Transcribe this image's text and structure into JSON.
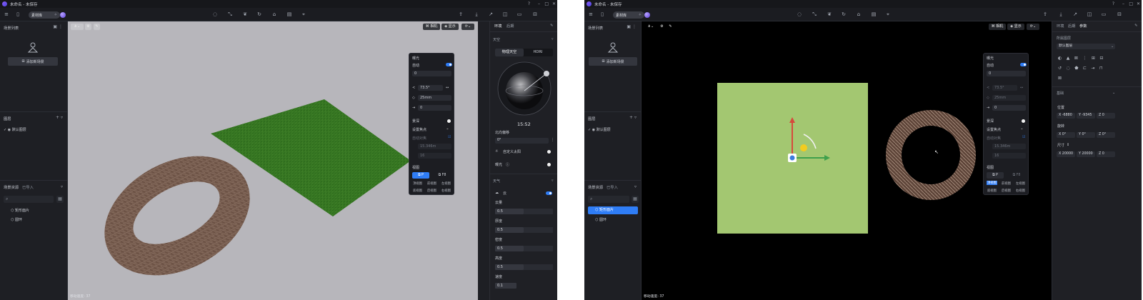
{
  "window": {
    "title": "未命名 - 未保存"
  },
  "toolbar": {
    "library_label": "素材库"
  },
  "left_panel": {
    "scene_list_title": "场景列表",
    "add_scene_button": "添加新场景",
    "layers_title": "图层",
    "default_layer": "默认图层",
    "assets_tab": "场景资源",
    "imported_tab": "已导入",
    "assets": [
      "矩形面片",
      "圆环"
    ]
  },
  "viewport": {
    "status": "移动速度: 37"
  },
  "top_buttons": {
    "camera": "相机",
    "display": "显示"
  },
  "camera_panel": {
    "exposure": "曝光",
    "auto": "自动",
    "exposure_value": "0",
    "fov_value": "73.5°",
    "focal_length": "25mm",
    "value3": "0",
    "depth_of_field": "景深",
    "set_focus": "设置焦点",
    "auto_focus": "自动对焦",
    "focus_distance": "15.346m",
    "fstop": "16",
    "view_title": "视图",
    "view_p": "P",
    "view_f8": "F8",
    "views": [
      "顶视图",
      "前视图",
      "左视图",
      "底视图",
      "后视图",
      "右视图"
    ]
  },
  "right_panel1": {
    "tab_env": "环境",
    "tab_post": "后期",
    "sky_section": "天空",
    "physical_sky": "物理天空",
    "hdri": "HDRI",
    "time": "15:52",
    "north_offset": "北向偏移",
    "north_value": "0°",
    "custom_sun": "自定义太阳",
    "exposure": "曝光",
    "weather": "天气",
    "cloud": "云",
    "cloud_amount": "云量",
    "cloud_amount_value": "0.5",
    "thickness": "厚度",
    "thickness_value": "0.5",
    "density": "密度",
    "density_value": "0.5",
    "height": "高度",
    "height_value": "0.5",
    "speed": "速度",
    "speed_value": "0.1"
  },
  "right_panel2": {
    "tab_env": "环境",
    "tab_post": "后期",
    "tab_params": "参数",
    "layer_section": "所属图层",
    "layer_value": "默认图层",
    "basic": "基础",
    "position": "位置",
    "pos": [
      "X -6880",
      "Y -9345",
      "Z 0"
    ],
    "rotation": "旋转",
    "rot": [
      "X 0°",
      "Y 0°",
      "Z 0°"
    ],
    "size": "尺寸",
    "dims": [
      "X 20000",
      "Y 20000",
      "Z 0"
    ]
  },
  "colors": {
    "accent": "#2f7df6",
    "grass": "#2f6e1f",
    "plane_top": "#a3c771"
  }
}
